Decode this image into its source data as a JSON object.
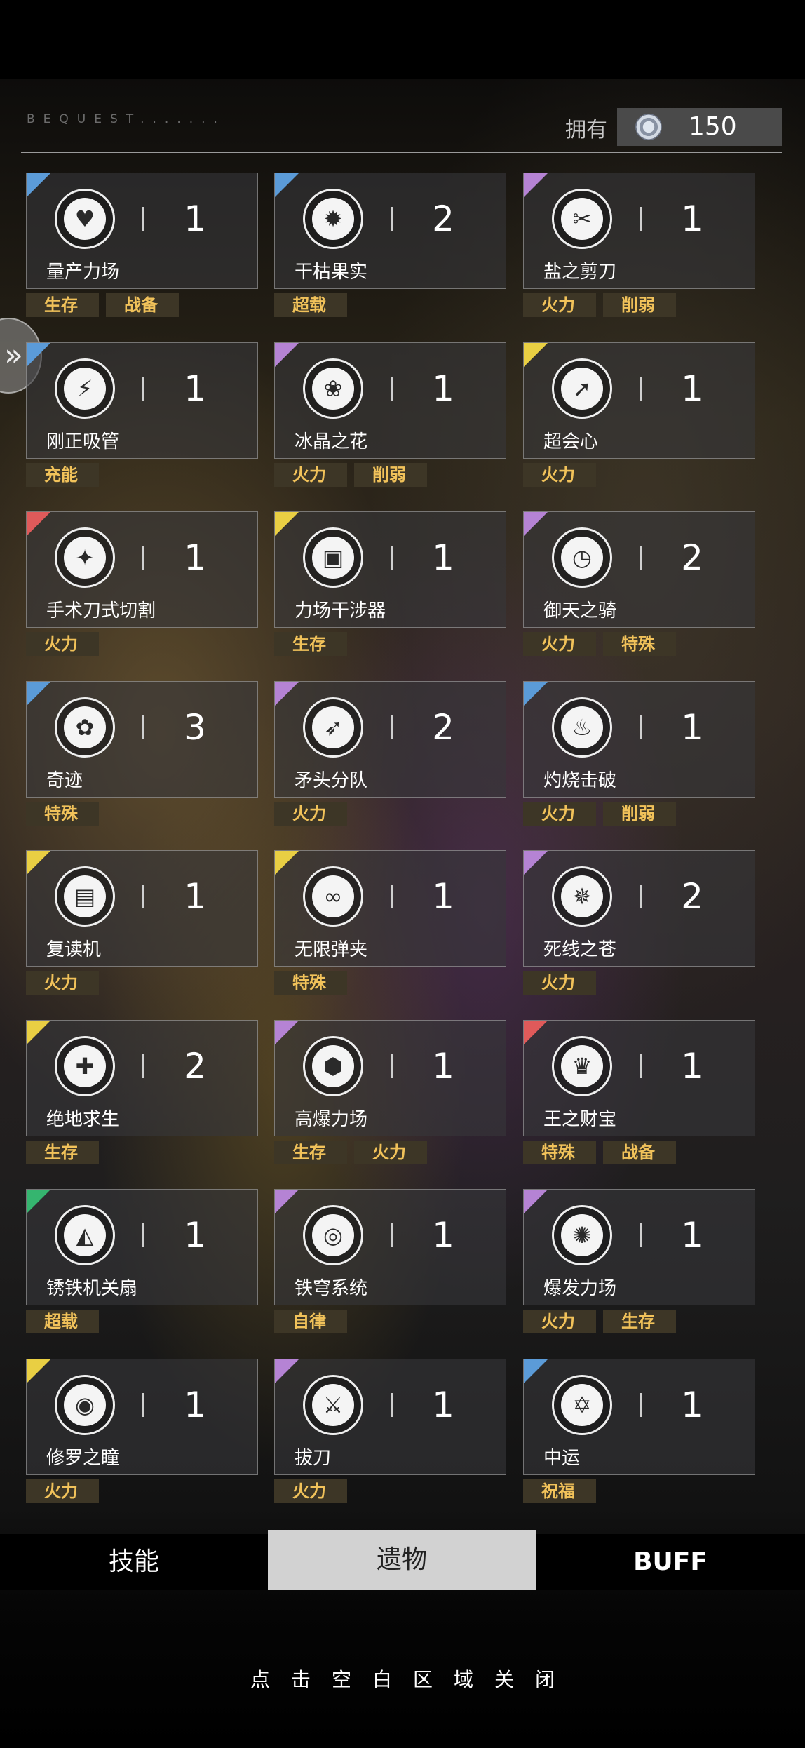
{
  "header": {
    "bequest": "BEQUEST.......",
    "owned_label": "拥有",
    "currency_value": "150"
  },
  "colors": {
    "blue": "#5b9bd8",
    "purple": "#b583d4",
    "yellow": "#e9cf43",
    "red": "#e05a5a",
    "green": "#35b56f",
    "tag_text": "#f1c25a"
  },
  "relics": [
    {
      "name": "量产力场",
      "count": "1",
      "rarity": "blue",
      "icon": "heart-cells-icon",
      "tags": [
        "生存",
        "战备"
      ]
    },
    {
      "name": "干枯果实",
      "count": "2",
      "rarity": "blue",
      "icon": "withered-fruit-icon",
      "tags": [
        "超载"
      ]
    },
    {
      "name": "盐之剪刀",
      "count": "1",
      "rarity": "purple",
      "icon": "scissors-icon",
      "tags": [
        "火力",
        "削弱"
      ]
    },
    {
      "name": "刚正吸管",
      "count": "1",
      "rarity": "blue",
      "icon": "straw-icon",
      "tags": [
        "充能"
      ]
    },
    {
      "name": "冰晶之花",
      "count": "1",
      "rarity": "purple",
      "icon": "ice-flower-icon",
      "tags": [
        "火力",
        "削弱"
      ]
    },
    {
      "name": "超会心",
      "count": "1",
      "rarity": "yellow",
      "icon": "critical-arrow-icon",
      "tags": [
        "火力"
      ]
    },
    {
      "name": "手术刀式切割",
      "count": "1",
      "rarity": "red",
      "icon": "scalpel-icon",
      "tags": [
        "火力"
      ]
    },
    {
      "name": "力场干涉器",
      "count": "1",
      "rarity": "yellow",
      "icon": "field-interferer-icon",
      "tags": [
        "生存"
      ]
    },
    {
      "name": "御天之骑",
      "count": "2",
      "rarity": "purple",
      "icon": "clock-icon",
      "tags": [
        "火力",
        "特殊"
      ]
    },
    {
      "name": "奇迹",
      "count": "3",
      "rarity": "blue",
      "icon": "miracle-flower-icon",
      "tags": [
        "特殊"
      ]
    },
    {
      "name": "矛头分队",
      "count": "2",
      "rarity": "purple",
      "icon": "spearhead-soldier-icon",
      "tags": [
        "火力"
      ]
    },
    {
      "name": "灼烧击破",
      "count": "1",
      "rarity": "blue",
      "icon": "flame-icon",
      "tags": [
        "火力",
        "削弱"
      ]
    },
    {
      "name": "复读机",
      "count": "1",
      "rarity": "yellow",
      "icon": "repeater-icon",
      "tags": [
        "火力"
      ]
    },
    {
      "name": "无限弹夹",
      "count": "1",
      "rarity": "yellow",
      "icon": "infinite-ammo-icon",
      "tags": [
        "特殊"
      ]
    },
    {
      "name": "死线之苍",
      "count": "2",
      "rarity": "purple",
      "icon": "deadline-star-icon",
      "tags": [
        "火力"
      ]
    },
    {
      "name": "绝地求生",
      "count": "2",
      "rarity": "yellow",
      "icon": "medkit-icon",
      "tags": [
        "生存"
      ]
    },
    {
      "name": "高爆力场",
      "count": "1",
      "rarity": "purple",
      "icon": "hex-cluster-icon",
      "tags": [
        "生存",
        "火力"
      ]
    },
    {
      "name": "王之财宝",
      "count": "1",
      "rarity": "red",
      "icon": "king-treasure-icon",
      "tags": [
        "特殊",
        "战备"
      ]
    },
    {
      "name": "锈铁机关扇",
      "count": "1",
      "rarity": "green",
      "icon": "iron-fan-icon",
      "tags": [
        "超载"
      ]
    },
    {
      "name": "铁穹系统",
      "count": "1",
      "rarity": "purple",
      "icon": "target-icon",
      "tags": [
        "自律"
      ]
    },
    {
      "name": "爆发力场",
      "count": "1",
      "rarity": "purple",
      "icon": "burst-field-icon",
      "tags": [
        "火力",
        "生存"
      ]
    },
    {
      "name": "修罗之瞳",
      "count": "1",
      "rarity": "yellow",
      "icon": "asura-eye-icon",
      "tags": [
        "火力"
      ]
    },
    {
      "name": "拔刀",
      "count": "1",
      "rarity": "purple",
      "icon": "draw-sword-icon",
      "tags": [
        "火力"
      ]
    },
    {
      "name": "中运",
      "count": "1",
      "rarity": "blue",
      "icon": "hexagram-icon",
      "tags": [
        "祝福"
      ]
    }
  ],
  "tabs": {
    "skill": "技能",
    "relic": "遗物",
    "buff": "BUFF"
  },
  "close_hint": "点击空白区域关闭"
}
